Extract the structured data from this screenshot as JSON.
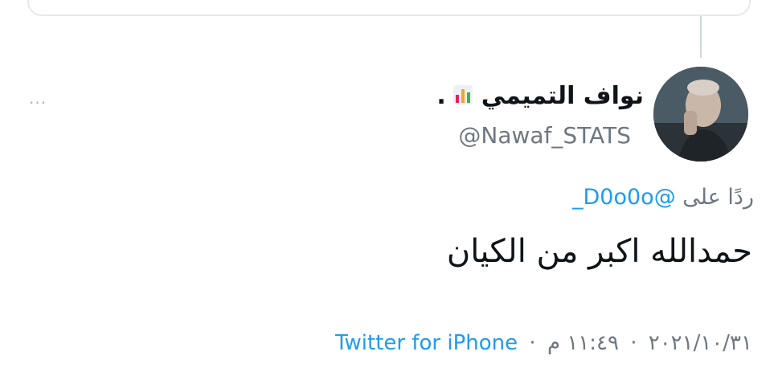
{
  "tweet": {
    "display_name": "نواف التميمي",
    "name_suffix": ".",
    "name_icon": "bar-chart-icon",
    "handle": "@Nawaf_STATS",
    "reply_prefix": "ردًا على",
    "reply_mention": "@D0o0o_",
    "text": "حمدالله اكبر من الكيان",
    "date": "٢٠٢١/١٠/٣١",
    "time": "١١:٤٩ م",
    "separator": "·",
    "source": "Twitter for iPhone"
  },
  "colors": {
    "link": "#1d9bf0",
    "secondary_text": "#6e7780",
    "primary_text": "#0f1419"
  }
}
